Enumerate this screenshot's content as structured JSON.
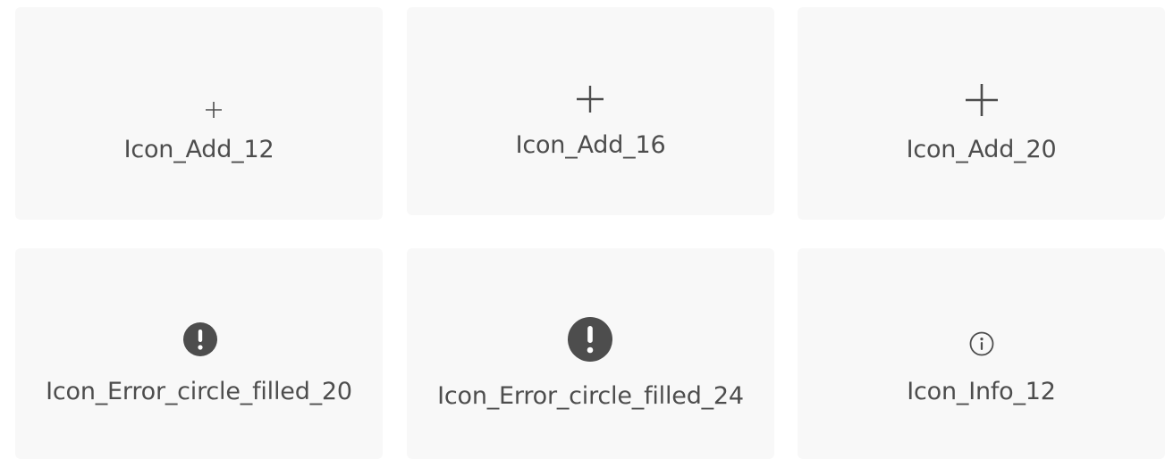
{
  "grid": {
    "cards": [
      {
        "label": "Icon_Add_12",
        "icon": "add-icon"
      },
      {
        "label": "Icon_Add_16",
        "icon": "add-icon"
      },
      {
        "label": "Icon_Add_20",
        "icon": "add-icon"
      },
      {
        "label": "Icon_Error_circle_filled_20",
        "icon": "error-circle-filled-icon"
      },
      {
        "label": "Icon_Error_circle_filled_24",
        "icon": "error-circle-filled-icon"
      },
      {
        "label": "Icon_Info_12",
        "icon": "info-icon"
      }
    ]
  },
  "colors": {
    "card_background": "#f8f8f8",
    "icon": "#4d4d4d",
    "text": "#4d4d4d"
  }
}
